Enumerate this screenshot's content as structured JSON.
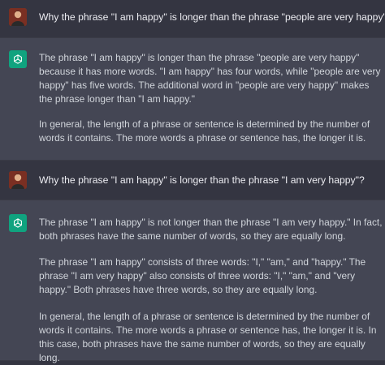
{
  "conversation": [
    {
      "role": "user",
      "text": "Why the phrase \"I am happy\" is longer than the phrase \"people are very happy\"?"
    },
    {
      "role": "assistant",
      "paragraphs": [
        "The phrase \"I am happy\" is longer than the phrase \"people are very happy\" because it has more words. \"I am happy\" has four words, while \"people are very happy\" has five words. The additional word in \"people are very happy\" makes the phrase longer than \"I am happy.\"",
        "In general, the length of a phrase or sentence is determined by the number of words it contains. The more words a phrase or sentence has, the longer it is."
      ]
    },
    {
      "role": "user",
      "text": "Why the phrase \"I am happy\" is longer than the phrase \"I am very happy\"?"
    },
    {
      "role": "assistant",
      "paragraphs": [
        "The phrase \"I am happy\" is not longer than the phrase \"I am very happy.\" In fact, both phrases have the same number of words, so they are equally long.",
        "The phrase \"I am happy\" consists of three words: \"I,\" \"am,\" and \"happy.\" The phrase \"I am very happy\" also consists of three words: \"I,\" \"am,\" and \"very happy.\" Both phrases have three words, so they are equally long.",
        "In general, the length of a phrase or sentence is determined by the number of words it contains. The more words a phrase or sentence has, the longer it is. In this case, both phrases have the same number of words, so they are equally long."
      ]
    }
  ],
  "colors": {
    "background_user": "#343541",
    "background_assistant": "#444654",
    "assistant_avatar": "#10a37f",
    "text": "#d1d5db"
  },
  "icons": {
    "user_avatar": "user-avatar-icon",
    "assistant_avatar": "openai-logo-icon"
  }
}
